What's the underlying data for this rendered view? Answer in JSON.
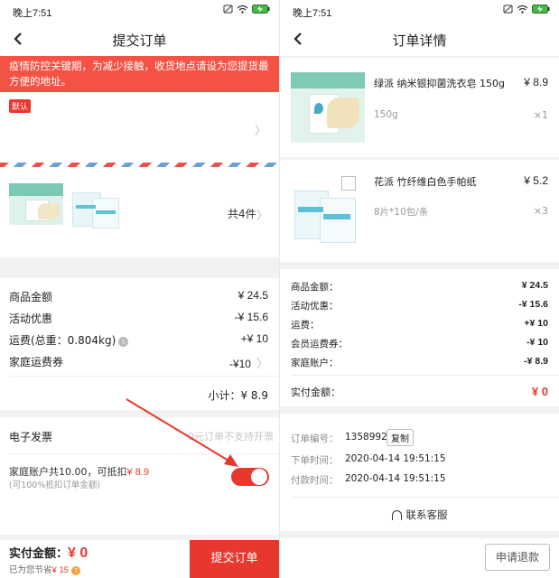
{
  "status_bar": {
    "time": "晚上7:51",
    "battery_icon": "battery-charging-icon",
    "wifi_icon": "wifi-icon",
    "signal_icon": "sim-icon"
  },
  "left": {
    "nav_title": "提交订单",
    "notice": "疫情防控关键期，为减少接触，收货地点请设为您提货最方便的地址。",
    "default_tag": "默认",
    "items_count": "共4件",
    "summary": [
      {
        "label": "商品金额",
        "value": "¥ 24.5"
      },
      {
        "label": "活动优惠",
        "value": "-¥ 15.6"
      },
      {
        "label": "运费(总重：0.804kg)",
        "value": "+¥ 10"
      },
      {
        "label": "家庭运费券",
        "value": "-¥10"
      }
    ],
    "subtotal": "小计：¥ 8.9",
    "invoice_label": "电子发票",
    "invoice_note": "0元订单不支持开票",
    "family_account_text": "家庭账户共10.00，可抵扣",
    "family_account_amount": "¥ 8.9",
    "family_account_sub": "(可100%抵扣订单金额)",
    "toggle_on": true,
    "pay_label": "实付金额：",
    "pay_amount": "¥ 0",
    "saved_label": "已为您节省",
    "saved_amount": "¥ 15",
    "submit_label": "提交订单",
    "colors": {
      "accent": "#e8372d",
      "notice_bg": "#f45245"
    }
  },
  "right": {
    "nav_title": "订单详情",
    "products": [
      {
        "name": "绿派 纳米银抑菌洗衣皂 150g",
        "price": "¥ 8.9",
        "spec": "150g",
        "qty": "×1"
      },
      {
        "name": "花派 竹纤维白色手帕纸",
        "price": "¥ 5.2",
        "spec": "8片*10包/条",
        "qty": "×3"
      }
    ],
    "summary": [
      {
        "label": "商品金额：",
        "value": "¥ 24.5"
      },
      {
        "label": "活动优惠：",
        "value": "-¥ 15.6"
      },
      {
        "label": "运费：",
        "value": "+¥ 10"
      },
      {
        "label": "会员运费券：",
        "value": "-¥ 10"
      },
      {
        "label": "家庭账户：",
        "value": "-¥ 8.9"
      }
    ],
    "paid_label": "实付金额：",
    "paid_value": "¥ 0",
    "order_no_label": "订单编号：",
    "order_no": "1358992",
    "copy_label": "复制",
    "order_time_label": "下单时间：",
    "order_time": "2020-04-14 19:51:15",
    "pay_time_label": "付款时间：",
    "pay_time": "2020-04-14 19:51:15",
    "service_label": "联系客服",
    "refund_label": "申请退款"
  }
}
